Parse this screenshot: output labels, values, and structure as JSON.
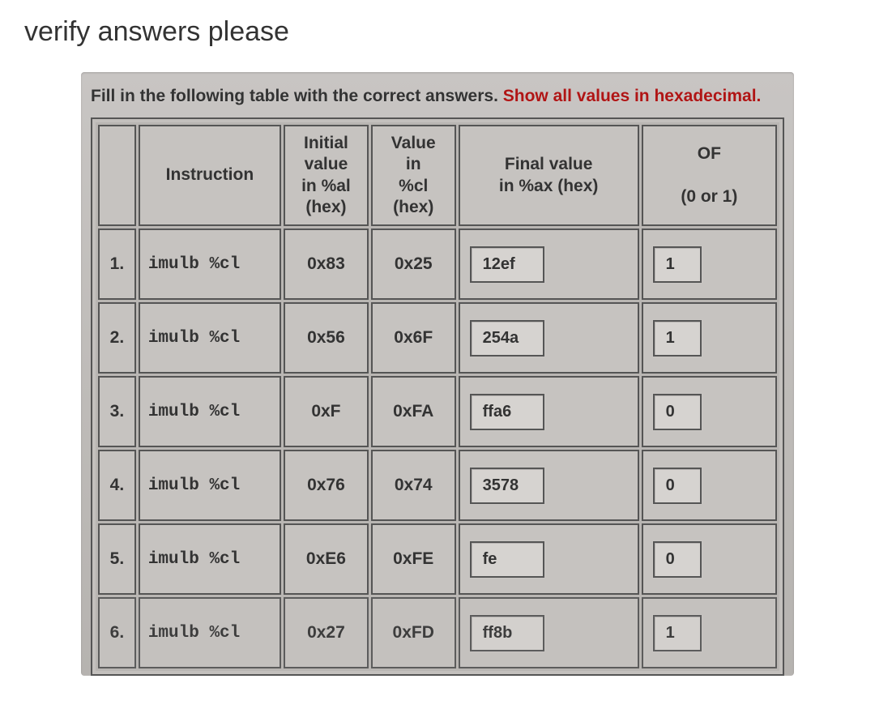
{
  "title": "verify answers please",
  "instruction": {
    "prefix": "Fill in the following table with the correct answers. ",
    "highlight": "Show all values in hexadecimal."
  },
  "headers": {
    "num": "",
    "instruction": "Instruction",
    "al": "Initial value in %al (hex)",
    "cl": "Value in %cl (hex)",
    "final": "Final value in %ax (hex)",
    "of": "OF\n\n(0 or 1)"
  },
  "rows": [
    {
      "num": "1.",
      "instr": "imulb %cl",
      "al": "0x83",
      "cl": "0x25",
      "final": "12ef",
      "of": "1"
    },
    {
      "num": "2.",
      "instr": "imulb %cl",
      "al": "0x56",
      "cl": "0x6F",
      "final": "254a",
      "of": "1"
    },
    {
      "num": "3.",
      "instr": "imulb %cl",
      "al": "0xF",
      "cl": "0xFA",
      "final": "ffa6",
      "of": "0"
    },
    {
      "num": "4.",
      "instr": "imulb %cl",
      "al": "0x76",
      "cl": "0x74",
      "final": "3578",
      "of": "0"
    },
    {
      "num": "5.",
      "instr": "imulb %cl",
      "al": "0xE6",
      "cl": "0xFE",
      "final": "fe",
      "of": "0"
    },
    {
      "num": "6.",
      "instr": "imulb %cl",
      "al": "0x27",
      "cl": "0xFD",
      "final": "ff8b",
      "of": "1"
    }
  ]
}
